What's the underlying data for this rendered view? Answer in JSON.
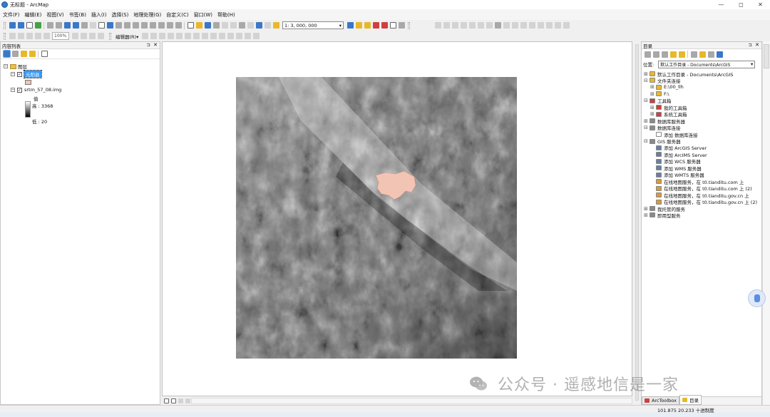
{
  "window": {
    "title": "无标题 - ArcMap",
    "controls": [
      "—",
      "◻",
      "✕"
    ]
  },
  "menu": [
    "文件(F)",
    "编辑(E)",
    "视图(V)",
    "书签(B)",
    "插入(I)",
    "选择(S)",
    "地理处理(G)",
    "自定义(C)",
    "窗口(W)",
    "帮助(H)"
  ],
  "toolbar": {
    "scale_value": "1: 3, 000, 000",
    "zoom_value": "100%",
    "editor_label": "编辑器(R)▾"
  },
  "toc": {
    "title": "内容列表",
    "pin": "⊐",
    "close": "✕",
    "group_label": "图层",
    "layers": [
      {
        "name": "元阳县",
        "checked": true,
        "selected": true,
        "symbol_color": "#f2c4b4"
      },
      {
        "name": "srtm_57_08.img",
        "checked": true,
        "legend_field": "值",
        "high_label": "高 : 3368",
        "low_label": "低 : 20"
      }
    ]
  },
  "catalog": {
    "title": "目录",
    "pin": "⊐",
    "close": "✕",
    "location_label": "位置:",
    "location_value": "默认工作目录 - Documents\\ArcGIS",
    "tree": [
      {
        "label": "默认工作目录 - Documents\\ArcGIS",
        "level": 0,
        "expander": "⊞",
        "icon": "home-folder-icon"
      },
      {
        "label": "文件夹连接",
        "level": 0,
        "expander": "⊟",
        "icon": "folder-connection-icon"
      },
      {
        "label": "E:\\00_llh",
        "level": 1,
        "expander": "⊞",
        "icon": "folder-icon"
      },
      {
        "label": "F:\\",
        "level": 1,
        "expander": "⊞",
        "icon": "folder-icon"
      },
      {
        "label": "工具箱",
        "level": 0,
        "expander": "⊟",
        "icon": "toolbox-icon"
      },
      {
        "label": "我的工具箱",
        "level": 1,
        "expander": "⊞",
        "icon": "toolbox-icon"
      },
      {
        "label": "系统工具箱",
        "level": 1,
        "expander": "⊞",
        "icon": "toolbox-icon"
      },
      {
        "label": "数据库服务器",
        "level": 0,
        "expander": "⊞",
        "icon": "database-server-icon"
      },
      {
        "label": "数据库连接",
        "level": 0,
        "expander": "⊟",
        "icon": "database-connection-icon"
      },
      {
        "label": "添加 数据库连接",
        "level": 1,
        "expander": "",
        "icon": "add-connection-icon"
      },
      {
        "label": "GIS 服务器",
        "level": 0,
        "expander": "⊟",
        "icon": "gis-server-icon"
      },
      {
        "label": "添加 ArcGIS Server",
        "level": 1,
        "expander": "",
        "icon": "server-icon"
      },
      {
        "label": "添加 ArcIMS Server",
        "level": 1,
        "expander": "",
        "icon": "server-icon"
      },
      {
        "label": "添加 WCS 服务器",
        "level": 1,
        "expander": "",
        "icon": "server-icon"
      },
      {
        "label": "添加 WMS 服务器",
        "level": 1,
        "expander": "",
        "icon": "server-icon"
      },
      {
        "label": "添加 WMTS 服务器",
        "level": 1,
        "expander": "",
        "icon": "server-icon"
      },
      {
        "label": "在线地图服务，在 t0.tianditu.com 上",
        "level": 1,
        "expander": "",
        "icon": "map-service-icon"
      },
      {
        "label": "在线地图服务，在 t0.tianditu.com 上 (2)",
        "level": 1,
        "expander": "",
        "icon": "map-service-icon"
      },
      {
        "label": "在线地图服务，在 t0.tianditu.gov.cn 上",
        "level": 1,
        "expander": "",
        "icon": "map-service-icon"
      },
      {
        "label": "在线地图服务，在 t0.tianditu.gov.cn 上 (2)",
        "level": 1,
        "expander": "",
        "icon": "map-service-icon"
      },
      {
        "label": "我托管的服务",
        "level": 0,
        "expander": "⊞",
        "icon": "hosted-services-icon"
      },
      {
        "label": "即用型服务",
        "level": 0,
        "expander": "⊞",
        "icon": "ready-services-icon"
      }
    ],
    "tabs": [
      "ArcToolbox",
      "目录"
    ]
  },
  "status": {
    "coordinates": "101.875  20.233 十进制度"
  },
  "watermark": "公众号 · 遥感地信是一家",
  "colors": {
    "selection": "#3399ff",
    "county_fill": "#f2c4b4"
  }
}
